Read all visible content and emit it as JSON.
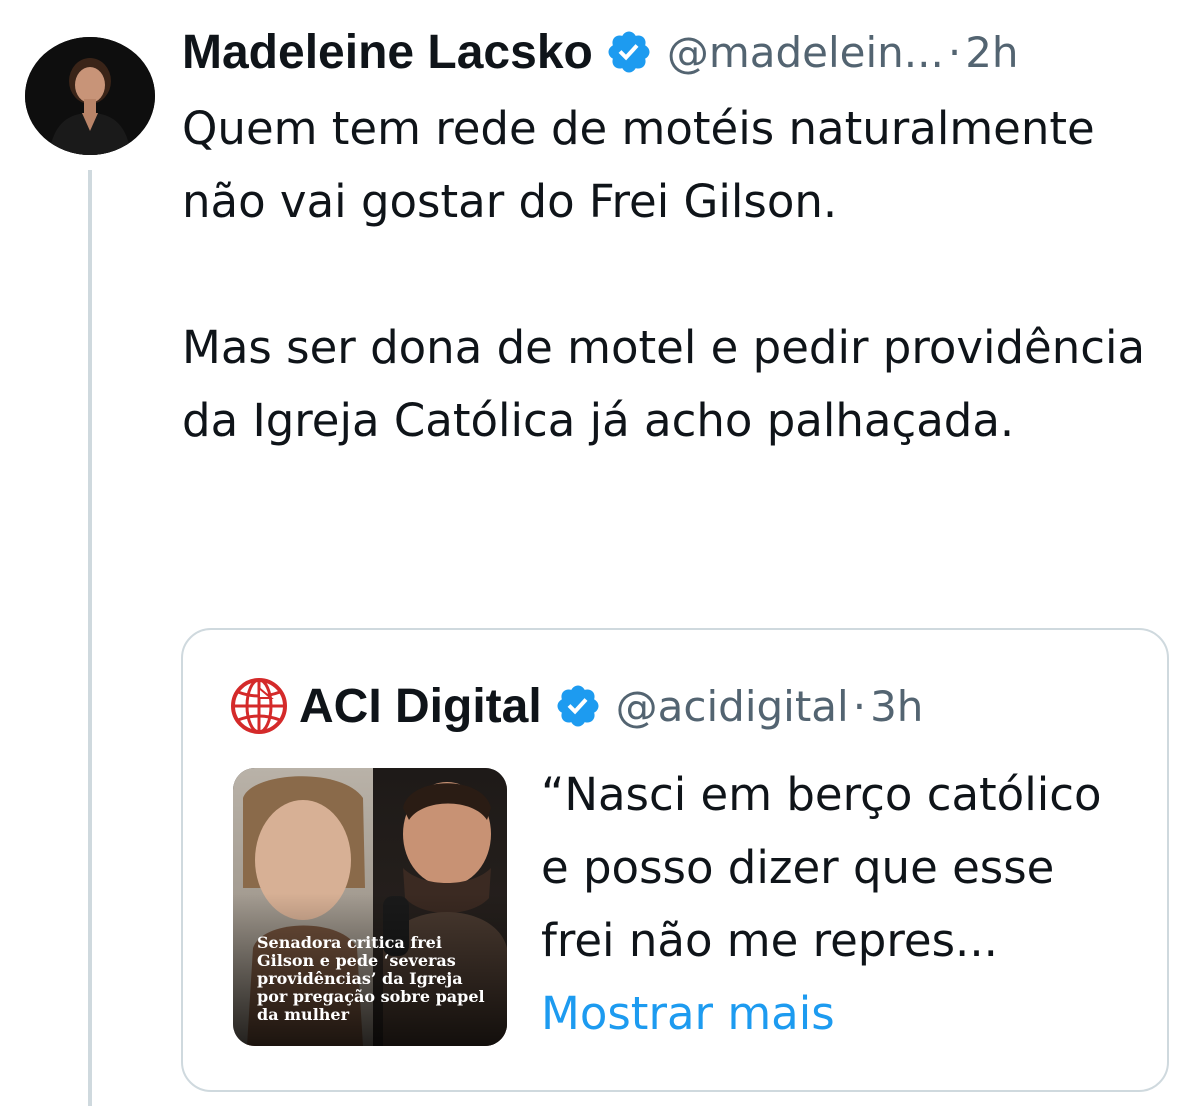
{
  "tweet": {
    "author": {
      "name": "Madeleine Lacsko",
      "handle": "@madelein...",
      "verified": true
    },
    "separator": "·",
    "time": "2h",
    "paragraphs": [
      "Quem tem rede de motéis naturalmente não vai gostar do Frei Gilson.",
      "Mas ser dona de motel e pedir providência da Igreja Católica já acho palhaçada."
    ]
  },
  "quote": {
    "author": {
      "name": "ACI Digital",
      "handle": "@acidigital",
      "verified": true
    },
    "separator": "·",
    "time": "3h",
    "text": "“Nasci em berço católico e posso dizer que esse frei não me repres...",
    "show_more": "Mostrar mais",
    "thumbnail_caption": "Senadora critica frei Gilson e pede ‘severas providências’ da Igreja por pregação sobre papel da mulher"
  },
  "colors": {
    "text": "#0f1419",
    "secondary": "#536471",
    "link": "#1d9bf0",
    "verified": "#1d9bf0",
    "border": "#cfd9de",
    "aci_red": "#d42a2a"
  },
  "icons": {
    "verified": "verified-badge-icon",
    "aci_logo": "aci-globe-logo-icon"
  }
}
